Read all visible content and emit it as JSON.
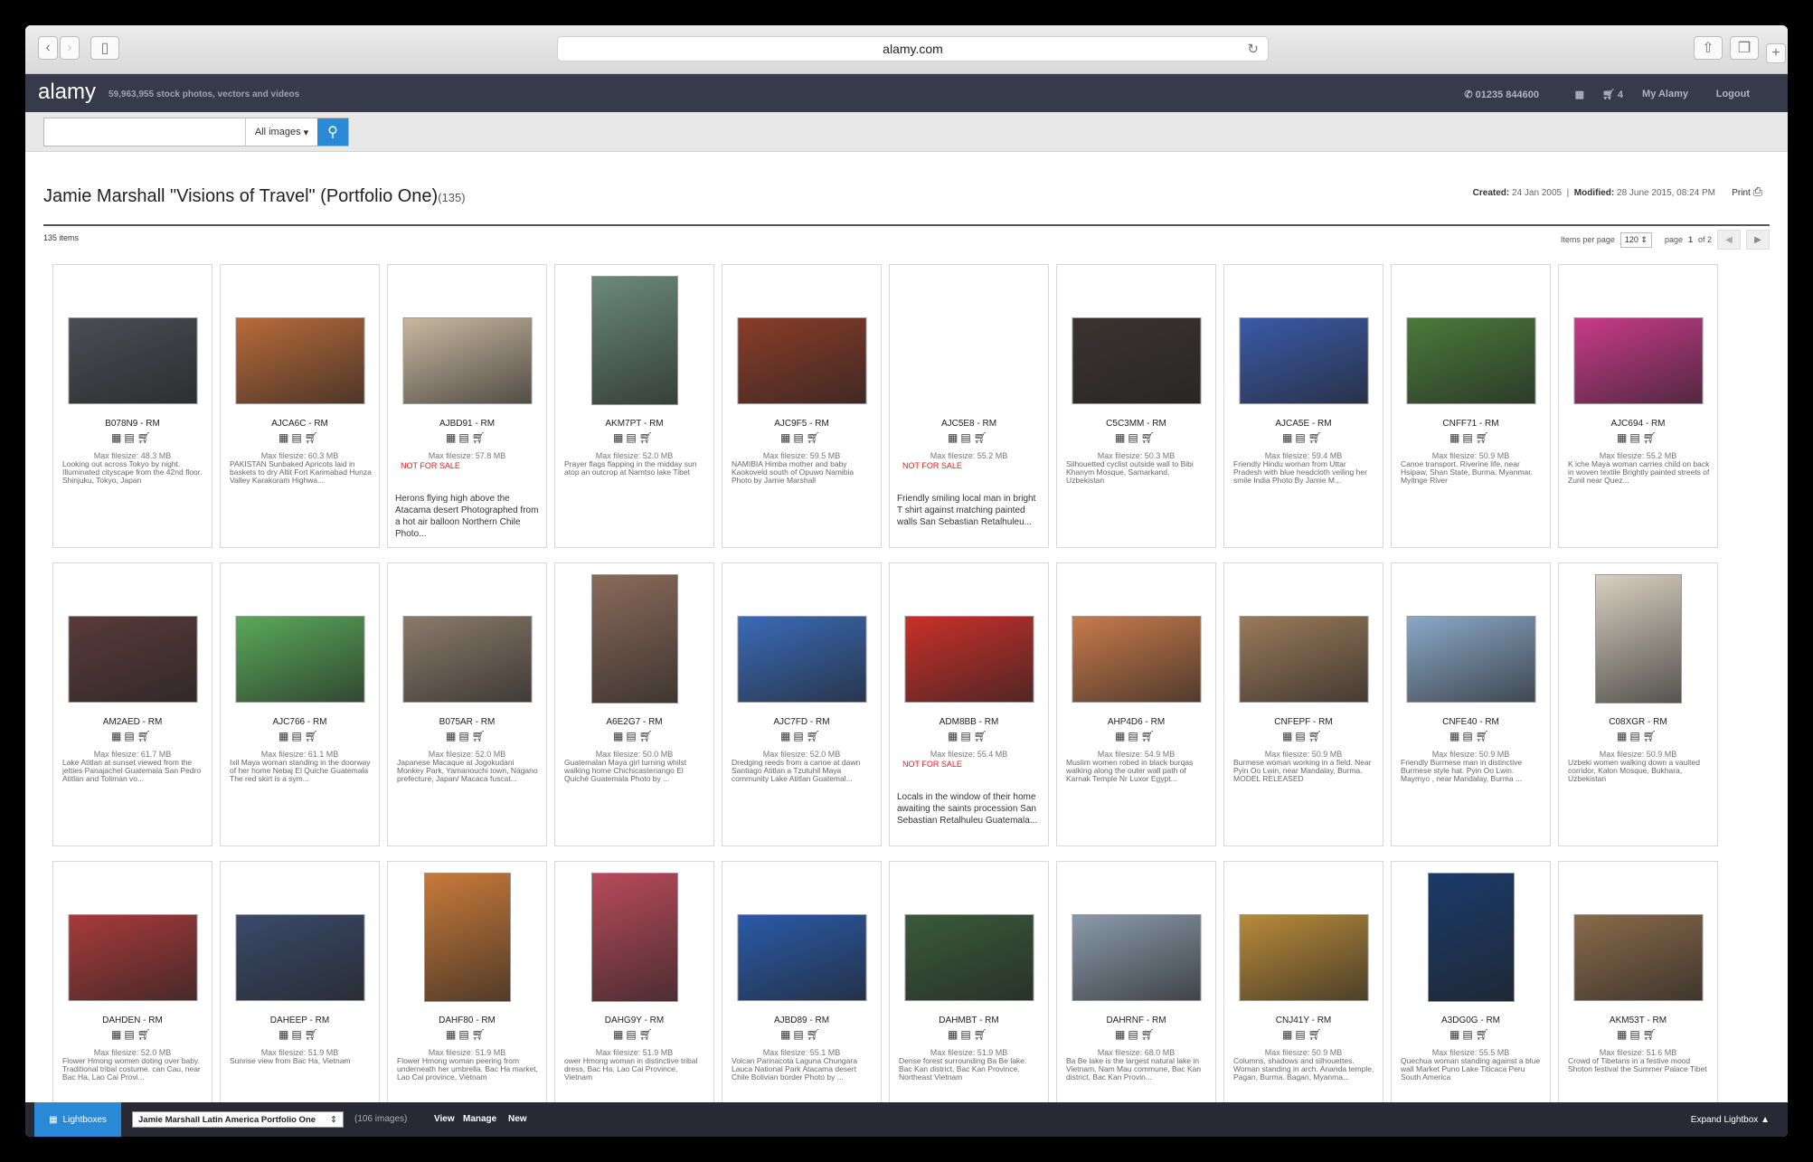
{
  "browser": {
    "url": "alamy.com"
  },
  "header": {
    "logo": "alamy",
    "tagline": "59,963,955  stock photos, vectors and videos",
    "phone": "01235 844600",
    "cart_count": "4",
    "my_alamy": "My Alamy",
    "logout": "Logout"
  },
  "search": {
    "placeholder": "",
    "scope": "All images"
  },
  "page": {
    "title": "Jamie Marshall \"Visions of Travel\" (Portfolio One)",
    "count": "(135)",
    "created_label": "Created:",
    "created_value": "24 Jan 2005",
    "modified_label": "Modified:",
    "modified_value": "28 June 2015, 08:24 PM",
    "print_label": "Print"
  },
  "toolbar": {
    "items": "135 items",
    "per_page_label": "Items per page",
    "per_page_value": "120",
    "page_label": "page",
    "page_current": "1",
    "page_of": "of 2"
  },
  "cards": [
    {
      "id": "B078N9 - RM",
      "size": "Max filesize: 48.3 MB",
      "desc": "Looking out across Tokyo by night. Illuminated cityscape from the 42nd floor. Shinjuku, Tokyo, Japan",
      "nfs": "",
      "color": "#4a4d55",
      "thumb": "land"
    },
    {
      "id": "AJCA6C - RM",
      "size": "Max filesize: 60.3 MB",
      "desc": "PAKISTAN Sunbaked Apricots laid in baskets to dry Altit Fort Karimabad Hunza Valley Karakoram Highwa...",
      "nfs": "",
      "color": "#b86a3a",
      "thumb": "land"
    },
    {
      "id": "AJBD91 - RM",
      "size": "Max filesize: 57.8 MB",
      "desc": "Herons flying high above the Atacama desert Photographed from a hot air balloon Northern Chile Photo...",
      "nfs": "NOT FOR SALE",
      "color": "#c9b8a0",
      "thumb": "land"
    },
    {
      "id": "AKM7PT - RM",
      "size": "Max filesize: 52.0 MB",
      "desc": "Prayer flags flapping in the midday sun atop an outcrop at Namtso lake Tibet",
      "nfs": "",
      "color": "#6a8a7a",
      "thumb": "port"
    },
    {
      "id": "AJC9F5 - RM",
      "size": "Max filesize: 59.5 MB",
      "desc": "NAMIBIA Himba mother and baby Kaokoveld south of Opuwo Namibia Photo by Jamie Marshall",
      "nfs": "",
      "color": "#8a3c28",
      "thumb": "land"
    },
    {
      "id": "AJC5E8 - RM",
      "size": "Max filesize: 55.2 MB",
      "desc": "Friendly smiling local man in bright T shirt against matching painted walls San Sebastian Retalhuleu...",
      "nfs": "NOT FOR SALE",
      "color": "#ffffff",
      "thumb": "none"
    },
    {
      "id": "C5C3MM - RM",
      "size": "Max filesize: 50.3 MB",
      "desc": "Silhouetted cyclist outside wall to Bibi Khanym Mosque, Samarkand, Uzbekistan",
      "nfs": "",
      "color": "#3a3330",
      "thumb": "land"
    },
    {
      "id": "AJCA5E - RM",
      "size": "Max filesize: 59.4 MB",
      "desc": "Friendly Hindu woman from Uttar Pradesh with blue headcloth veiling her smile India Photo By Jamie M...",
      "nfs": "",
      "color": "#3a5aa8",
      "thumb": "land"
    },
    {
      "id": "CNFF71 - RM",
      "size": "Max filesize: 50.9 MB",
      "desc": "Canoe transport. Riverine life, near Hsipaw, Shan State, Burma. Myanmar. Myitnge River",
      "nfs": "",
      "color": "#4a7a3a",
      "thumb": "land"
    },
    {
      "id": "AJC694 - RM",
      "size": "Max filesize: 55.2 MB",
      "desc": "K iche Maya woman carries child on back in woven textile Brightly painted streets of Zunil near Quez...",
      "nfs": "",
      "color": "#c83a8a",
      "thumb": "land"
    },
    {
      "id": "AM2AED - RM",
      "size": "Max filesize: 61.7 MB",
      "desc": "Lake Atitlan at sunset viewed from the jetties Panajachel Guatemala San Pedro Atitlan and Toliman vo...",
      "nfs": "",
      "color": "#5a3a3a",
      "thumb": "land"
    },
    {
      "id": "AJC766 - RM",
      "size": "Max filesize: 61.1 MB",
      "desc": "Ixil Maya woman standing in the doorway of her home Nebaj El Quiche Guatemala The red skirt is a sym...",
      "nfs": "",
      "color": "#5aa85a",
      "thumb": "land"
    },
    {
      "id": "B075AR - RM",
      "size": "Max filesize: 52.0 MB",
      "desc": "Japanese Macaque at Jogokudani Monkey Park, Yamanouchi town, Nagano prefecture, Japan/ Macaca fuscat...",
      "nfs": "",
      "color": "#8a7a6a",
      "thumb": "land"
    },
    {
      "id": "A6E2G7 - RM",
      "size": "Max filesize: 50.0 MB",
      "desc": "Guatemalan Maya girl turning whilst walking home Chichicastenango El Quiché Guatemala Photo by ...",
      "nfs": "",
      "color": "#8a6a5a",
      "thumb": "port"
    },
    {
      "id": "AJC7FD - RM",
      "size": "Max filesize: 52.0 MB",
      "desc": "Dredging reeds from a canoe at dawn Santiago Atitlan a Tzutuhil Maya community Lake Atitlan Guatemal...",
      "nfs": "",
      "color": "#3a6ab8",
      "thumb": "land"
    },
    {
      "id": "ADM8BB - RM",
      "size": "Max filesize: 55.4 MB",
      "desc": "Locals in the window of their home awaiting the saints procession San Sebastian Retalhuleu Guatemala...",
      "nfs": "NOT FOR SALE",
      "color": "#c8302a",
      "thumb": "land"
    },
    {
      "id": "AHP4D6 - RM",
      "size": "Max filesize: 54.9 MB",
      "desc": "Muslim women robed in black burqas walking along the outer wall path of Karnak Temple Nr Luxor Egypt...",
      "nfs": "",
      "color": "#c87a4a",
      "thumb": "land"
    },
    {
      "id": "CNFEPF - RM",
      "size": "Max filesize: 50.9 MB",
      "desc": "Burmese woman working in a field. Near Pyin Oo Lwin, near Mandalay, Burma. MODEL RELEASED",
      "nfs": "",
      "color": "#9a7a5a",
      "thumb": "land"
    },
    {
      "id": "CNFE40 - RM",
      "size": "Max filesize: 50.9 MB",
      "desc": "Friendly Burmese man in distinctive Burmese style hat. Pyin Oo Lwin. Maymyo , near Mandalay, Burma ...",
      "nfs": "",
      "color": "#8aa8c8",
      "thumb": "land"
    },
    {
      "id": "C08XGR - RM",
      "size": "Max filesize: 50.9 MB",
      "desc": "Uzbeki women walking down a vaulted corridor, Kalon Mosque, Bukhara, Uzbekistan",
      "nfs": "",
      "color": "#d8cfc0",
      "thumb": "port"
    },
    {
      "id": "DAHDEN - RM",
      "size": "Max filesize: 52.0 MB",
      "desc": "Flower Hmong women doting over baby. Traditional tribal costume. can Cau, near Bac Ha, Lao Cai Provi...",
      "nfs": "",
      "color": "#a83a3a",
      "thumb": "land"
    },
    {
      "id": "DAHEEP - RM",
      "size": "Max filesize: 51.9 MB",
      "desc": "Sunrise view from Bac Ha, Vietnam",
      "nfs": "",
      "color": "#3a4a6a",
      "thumb": "land"
    },
    {
      "id": "DAHF80 - RM",
      "size": "Max filesize: 51.9 MB",
      "desc": "Flower Hmong woman peering from underneath her umbrella. Bac Ha market, Lao Cai province, Vietnam",
      "nfs": "",
      "color": "#c87a3a",
      "thumb": "port"
    },
    {
      "id": "DAHG9Y - RM",
      "size": "Max filesize: 51.9 MB",
      "desc": "ower Hmong woman in distinctive tribal dress, Bac Ha. Lao Cai Province, Vietnam",
      "nfs": "",
      "color": "#b84a5a",
      "thumb": "port"
    },
    {
      "id": "AJBD89 - RM",
      "size": "Max filesize: 55.1 MB",
      "desc": "Volcan Parinacota Laguna Chungara Lauca National Park Atacama desert Chile Bolivian border Photo by ...",
      "nfs": "",
      "color": "#2a5aa8",
      "thumb": "land"
    },
    {
      "id": "DAHMBT - RM",
      "size": "Max filesize: 51.9 MB",
      "desc": "Dense forest surrounding Ba Be lake. Bac Kan district, Bac Kan Province. Northeast Vietnam",
      "nfs": "",
      "color": "#3a5a3a",
      "thumb": "land"
    },
    {
      "id": "DAHRNF - RM",
      "size": "Max filesize: 68.0 MB",
      "desc": "Ba Be lake is the largest natural lake in Vietnam. Nam Mau commune, Bac Kan district, Bac Kan Provin...",
      "nfs": "",
      "color": "#8a9aaa",
      "thumb": "land"
    },
    {
      "id": "CNJ41Y - RM",
      "size": "Max filesize: 50.9 MB",
      "desc": "Columns, shadows and silhouettes. Woman standing in arch. Ananda temple, Pagan, Burma. Bagan, Myanma...",
      "nfs": "",
      "color": "#b88a3a",
      "thumb": "land"
    },
    {
      "id": "A3DG0G - RM",
      "size": "Max filesize: 55.5 MB",
      "desc": "Quechua woman standing against a blue wall Market Puno Lake Titicaca Peru South America",
      "nfs": "",
      "color": "#1a3a6a",
      "thumb": "port"
    },
    {
      "id": "AKM53T - RM",
      "size": "Max filesize: 51.6 MB",
      "desc": "Crowd of Tibetans in a festive mood Shoton festival the Summer Palace Tibet",
      "nfs": "",
      "color": "#8a6a4a",
      "thumb": "land"
    }
  ],
  "bottom": {
    "lightboxes": "Lightboxes",
    "selected_lightbox": "Jamie Marshall Latin America Portfolio One",
    "image_count": "(106 images)",
    "view": "View",
    "manage": "Manage",
    "new": "New",
    "expand": "Expand Lightbox"
  }
}
